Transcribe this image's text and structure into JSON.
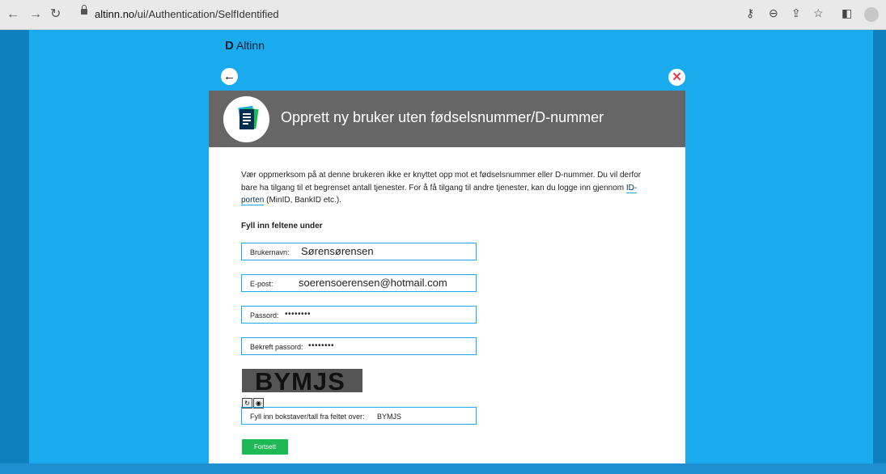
{
  "browser": {
    "url_prefix": "altinn.no",
    "url_path": "/ui/Authentication/SelfIdentified"
  },
  "header": {
    "logo_text": "Altinn"
  },
  "dialog": {
    "title": "Opprett ny bruker uten fødselsnummer/D-nummer",
    "info_before_link": "Vær oppmerksom på at denne brukeren ikke er knyttet opp mot et fødselsnummer eller D-nummer. Du vil derfor bare ha tilgang til et begrenset antall tjenester. For å få tilgang til andre tjenester, kan du logge inn gjennom ",
    "info_link": "ID-porten",
    "info_after_link": " (MinID, BankID etc.).",
    "section_title": "Fyll inn feltene under",
    "fields": {
      "username": {
        "label": "Brukernavn:",
        "value": "Sørensørensen"
      },
      "email": {
        "label": "E-post:",
        "value": "soerensoerensen@hotmail.com"
      },
      "password": {
        "label": "Passord:",
        "value": "••••••••"
      },
      "confirm": {
        "label": "Bekreft passord:",
        "value": "••••••••"
      },
      "captcha_input": {
        "label": "Fyll inn bokstaver/tall fra feltet over:",
        "value": "BYMJS"
      }
    },
    "captcha_text": "BYMJS",
    "submit_label": "Fortsett"
  },
  "colors": {
    "page_bg": "#1aabee",
    "header_bg": "#666666",
    "accent": "#1aabee",
    "button": "#1eb854",
    "close": "#e23b53"
  }
}
